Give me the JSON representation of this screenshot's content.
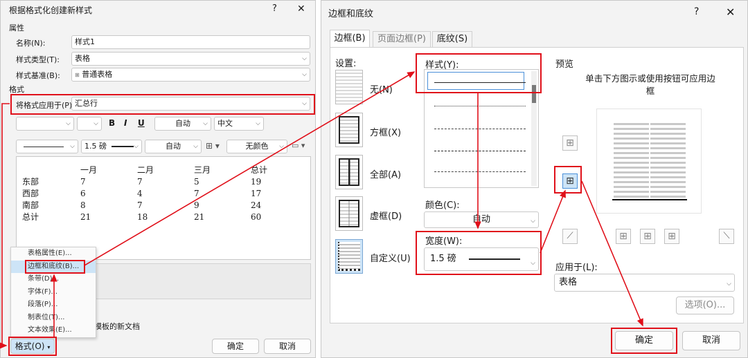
{
  "left": {
    "title": "根据格式化创建新样式",
    "help": "?",
    "close": "✕",
    "section_props": "属性",
    "name_label": "名称(N):",
    "name_value": "样式1",
    "type_label": "样式类型(T):",
    "type_value": "表格",
    "base_label": "样式基准(B):",
    "base_value": "普通表格",
    "section_format": "格式",
    "apply_label": "将格式应用于(P):",
    "apply_value": "汇总行",
    "bold": "B",
    "italic": "I",
    "underline": "U",
    "color_auto": "自动",
    "lang": "中文",
    "weight": "1.5 磅",
    "color_auto2": "自动",
    "shading": "无颜色",
    "table": {
      "header": [
        "",
        "一月",
        "二月",
        "三月",
        "总计"
      ],
      "rows": [
        [
          "东部",
          "7",
          "7",
          "5",
          "19"
        ],
        [
          "西部",
          "6",
          "4",
          "7",
          "17"
        ],
        [
          "南部",
          "8",
          "7",
          "9",
          "24"
        ],
        [
          "总计",
          "21",
          "18",
          "21",
          "60"
        ]
      ]
    },
    "menu": [
      "表格属性(E)...",
      "边框和底纹(B)...",
      "条带(D)...",
      "字体(F)...",
      "段落(P)...",
      "制表位(T)...",
      "文本效果(E)..."
    ],
    "template_note": "该模板的新文档",
    "format_btn": "格式(O)",
    "ok": "确定",
    "cancel": "取消"
  },
  "right": {
    "title": "边框和底纹",
    "help": "?",
    "close": "✕",
    "tabs": [
      "边框(B)",
      "页面边框(P)",
      "底纹(S)"
    ],
    "settings_label": "设置:",
    "settings": [
      "无(N)",
      "方框(X)",
      "全部(A)",
      "虚框(D)",
      "自定义(U)"
    ],
    "style_label": "样式(Y):",
    "color_label": "颜色(C):",
    "color_value": "自动",
    "width_label": "宽度(W):",
    "width_value": "1.5 磅",
    "preview_label": "预览",
    "preview_hint": "单击下方图示或使用按钮可应用边框",
    "apply_label": "应用于(L):",
    "apply_value": "表格",
    "options_btn": "选项(O)...",
    "ok": "确定",
    "cancel": "取消"
  },
  "colors": {
    "highlight": "#e0101a",
    "selection": "#cde4f7"
  }
}
